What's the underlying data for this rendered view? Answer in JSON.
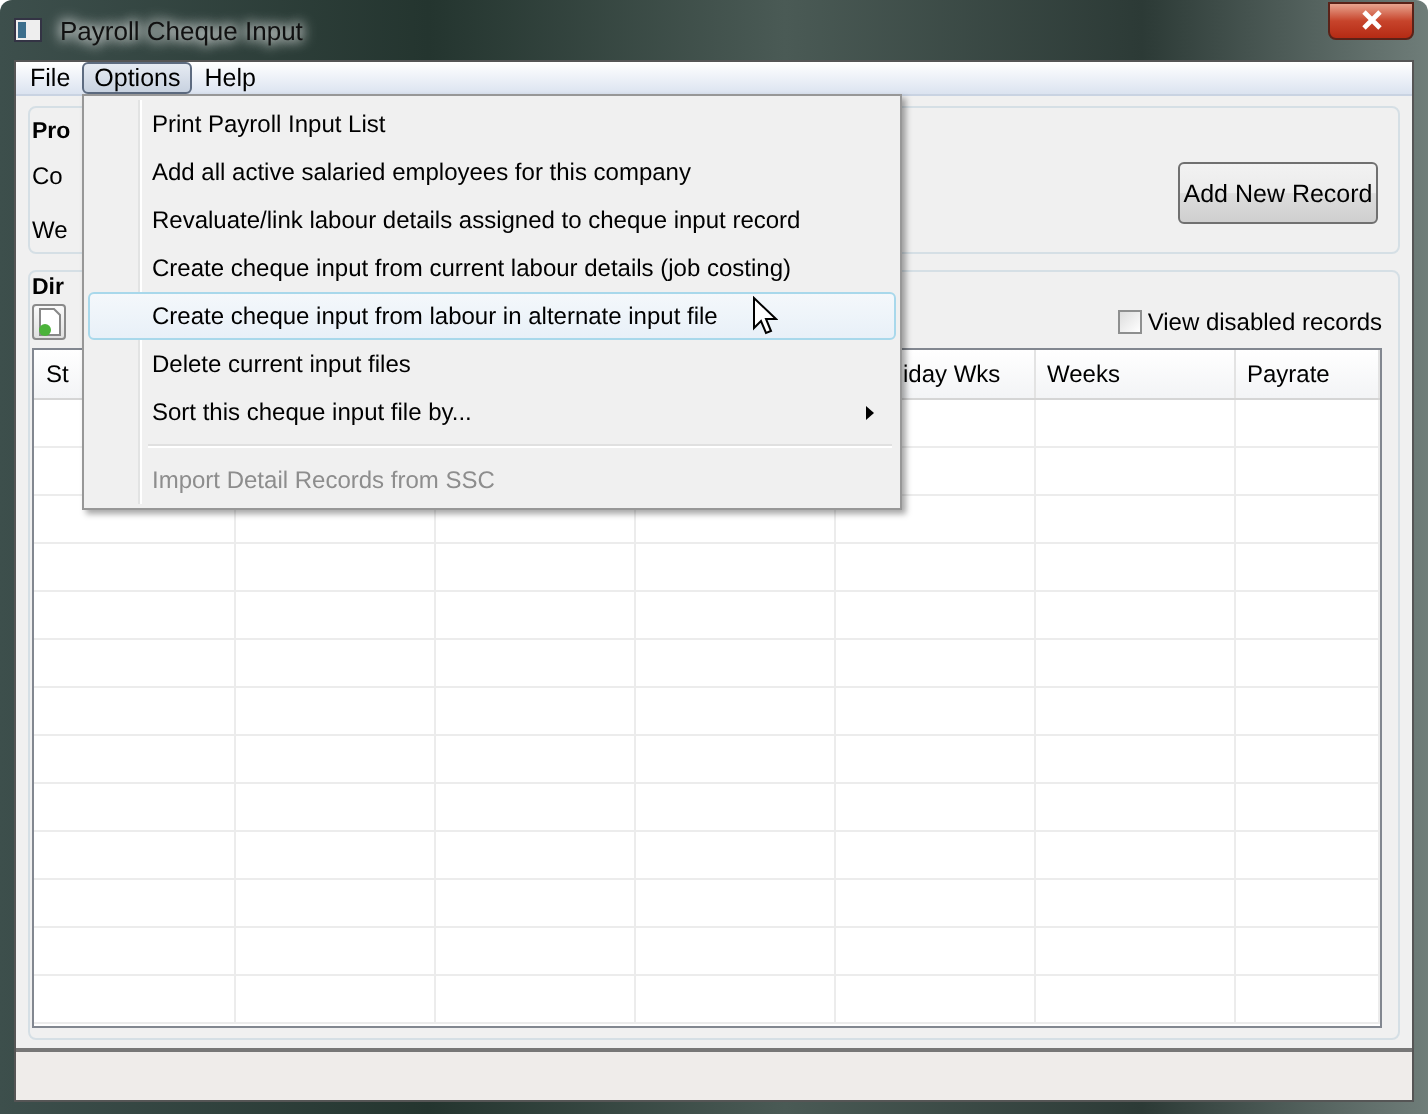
{
  "window": {
    "title": "Payroll Cheque Input"
  },
  "menubar": [
    {
      "label": "File",
      "selected": false
    },
    {
      "label": "Options",
      "selected": true
    },
    {
      "label": "Help",
      "selected": false
    }
  ],
  "properties_panel": {
    "title": "Pro",
    "labels": [
      "Co",
      "We"
    ],
    "add_button": "Add New Record"
  },
  "details_panel": {
    "title": "Dir",
    "view_disabled": {
      "label": "View disabled records",
      "checked": false
    },
    "columns": [
      "St",
      null,
      null,
      null,
      "iday Wks",
      "Weeks",
      "Payrate"
    ]
  },
  "options_menu": [
    {
      "kind": "item",
      "label": "Print Payroll Input List",
      "selected": false,
      "disabled": false
    },
    {
      "kind": "item",
      "label": "Add all active salaried employees for this company",
      "selected": false,
      "disabled": false
    },
    {
      "kind": "item",
      "label": "Revaluate/link labour details assigned to cheque input record",
      "selected": false,
      "disabled": false
    },
    {
      "kind": "item",
      "label": "Create cheque input from current labour details (job costing)",
      "selected": false,
      "disabled": false
    },
    {
      "kind": "item",
      "label": "Create cheque input from labour in alternate input file",
      "selected": true,
      "disabled": false
    },
    {
      "kind": "item",
      "label": "Delete current input files",
      "selected": false,
      "disabled": false
    },
    {
      "kind": "submenu",
      "label": "Sort this cheque input file by...",
      "selected": false,
      "disabled": false
    },
    {
      "kind": "separator"
    },
    {
      "kind": "item",
      "label": "Import Detail Records from SSC",
      "selected": false,
      "disabled": true
    }
  ]
}
